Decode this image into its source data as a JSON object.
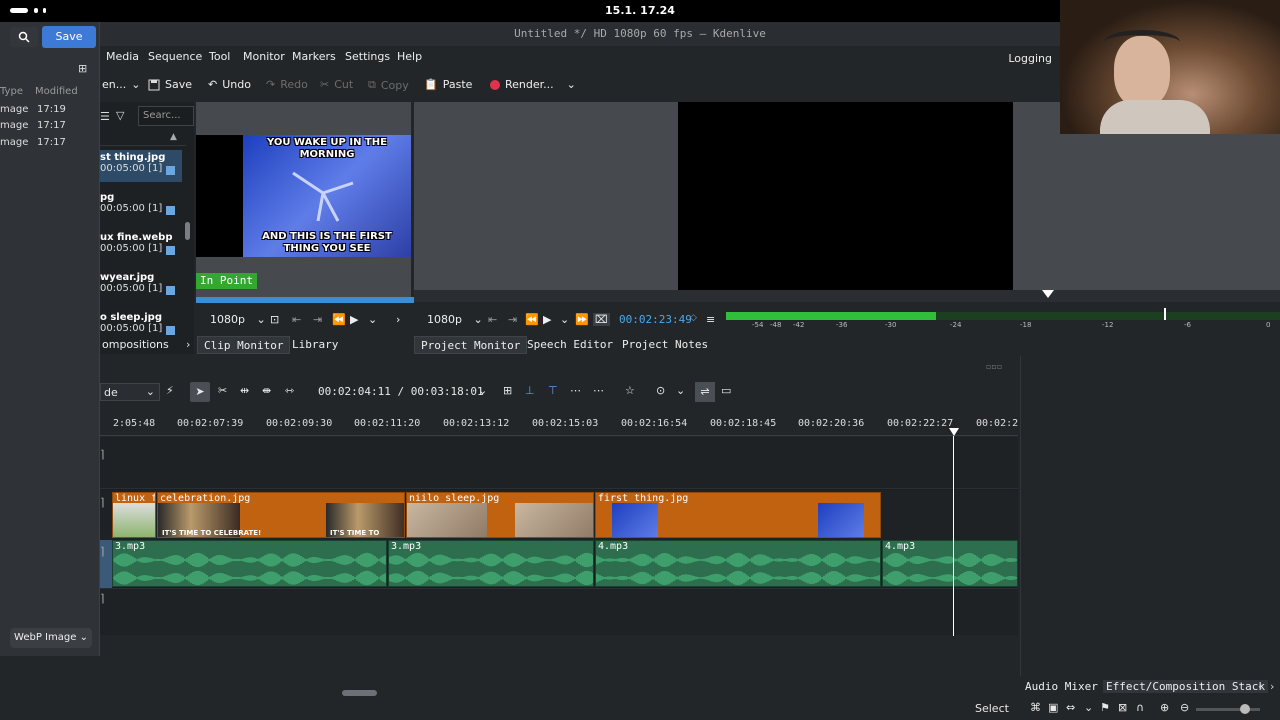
{
  "system": {
    "clock": "15.1. 17.24"
  },
  "window": {
    "title": "Untitled */ HD 1080p 60 fps — Kdenlive"
  },
  "menu": [
    "Media",
    "Sequence",
    "Tool",
    "Monitor",
    "Markers",
    "Settings",
    "Help"
  ],
  "logging_label": "Logging",
  "toolbar": {
    "project_label": "en...",
    "save": "Save",
    "undo": "Undo",
    "redo": "Redo",
    "cut": "Cut",
    "copy": "Copy",
    "paste": "Paste",
    "render": "Render..."
  },
  "file_dialog": {
    "save_button": "Save",
    "col_type": "Type",
    "col_modified": "Modified",
    "rows": [
      {
        "type": "mage",
        "modified": "17:19"
      },
      {
        "type": "mage",
        "modified": "17:17"
      },
      {
        "type": "mage",
        "modified": "17:17"
      }
    ],
    "format": "WebP Image"
  },
  "bin": {
    "search_placeholder": "Searc...",
    "items": [
      {
        "name": "st thing.jpg",
        "duration": "00:05:00 [1]"
      },
      {
        "name": "pg",
        "duration": "00:05:00 [1]"
      },
      {
        "name": "ux fine.webp",
        "duration": "00:05:00 [1]"
      },
      {
        "name": "wyear.jpg",
        "duration": "00:05:00 [1]"
      },
      {
        "name": "o sleep.jpg",
        "duration": "00:05:00 [1]"
      }
    ],
    "tab_compositions": "ompositions"
  },
  "clip_monitor": {
    "meme_top": "YOU WAKE UP IN THE MORNING",
    "meme_bottom": "AND THIS IS THE FIRST THING YOU SEE",
    "in_point": "In Point",
    "resolution": "1080p",
    "tab_clip_monitor": "Clip Monitor",
    "tab_library": "Library"
  },
  "project_monitor": {
    "resolution": "1080p",
    "timecode": "00:02:23:49",
    "tab_project_monitor": "Project Monitor",
    "tab_speech_editor": "Speech Editor",
    "tab_project_notes": "Project Notes",
    "meter_labels": [
      "-54",
      "-48",
      "-42",
      "-36",
      "-30",
      "-24",
      "-18",
      "-12",
      "-6",
      "0"
    ]
  },
  "timeline": {
    "mode": "de",
    "position": "00:02:04:11 / 00:03:18:01",
    "ruler": [
      "2:05:48",
      "00:02:07:39",
      "00:02:09:30",
      "00:02:11:20",
      "00:02:13:12",
      "00:02:15:03",
      "00:02:16:54",
      "00:02:18:45",
      "00:02:20:36",
      "00:02:22:27",
      "00:02:2"
    ],
    "video_clips": [
      {
        "label": "linux f"
      },
      {
        "label": "celebration.jpg"
      },
      {
        "label": "niilo sleep.jpg"
      },
      {
        "label": "first thing.jpg"
      }
    ],
    "audio_clips": [
      {
        "label": "3.mp3"
      },
      {
        "label": "3.mp3"
      },
      {
        "label": "4.mp3"
      },
      {
        "label": "4.mp3"
      }
    ],
    "thumb_caption": "IT'S TIME TO CELEBRATE!"
  },
  "right_panel": {
    "tab_audio_mixer": "Audio Mixer",
    "tab_effect_stack": "Effect/Composition Stack"
  },
  "status": {
    "mode": "Select"
  },
  "colors": {
    "accent": "#3d7ad6",
    "in_point": "#32a82f",
    "clip_video": "#c0620f",
    "clip_audio": "#2d6e4e",
    "meter_green": "#2fbf3a"
  }
}
